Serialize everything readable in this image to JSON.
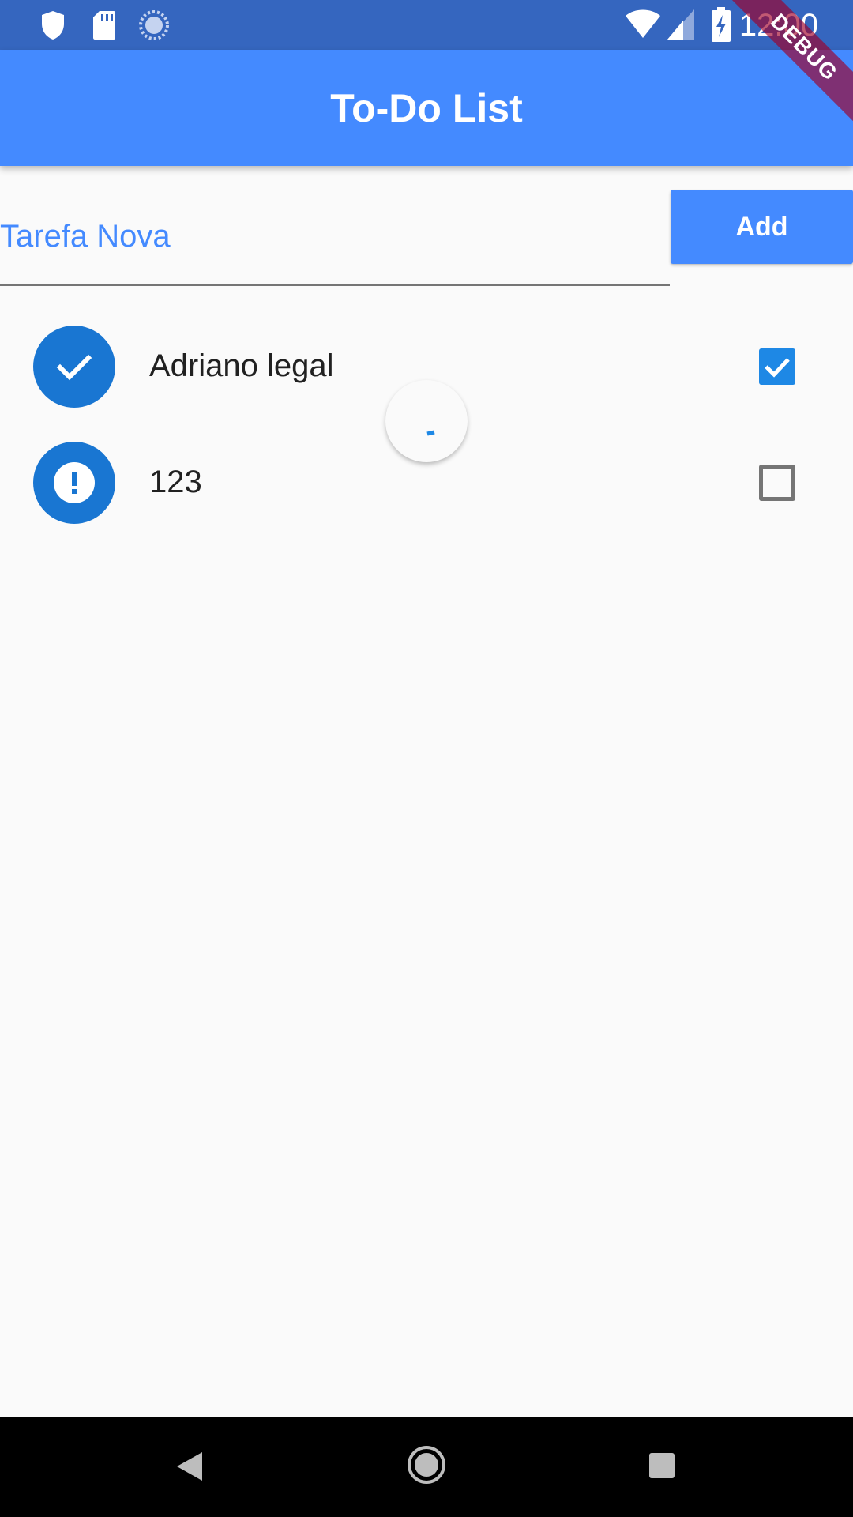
{
  "status_bar": {
    "time": "12:00",
    "left_icons": [
      "shield-icon",
      "sd-card-icon",
      "sync-icon"
    ],
    "right_icons": [
      "wifi-icon",
      "cell-signal-icon",
      "battery-charging-icon"
    ]
  },
  "debug_banner": {
    "label": "DEBUG"
  },
  "app_bar": {
    "title": "To-Do List"
  },
  "new_task": {
    "placeholder": "Tarefa Nova",
    "value": "",
    "add_label": "Add"
  },
  "tasks": [
    {
      "label": "Adriano legal",
      "done": true,
      "status_icon": "check-icon"
    },
    {
      "label": "123",
      "done": false,
      "status_icon": "error-icon"
    }
  ],
  "nav_bar": {
    "buttons": [
      "back-icon",
      "home-icon",
      "recents-icon"
    ]
  },
  "colors": {
    "status_bar": "#3566bf",
    "primary": "#448aff",
    "avatar": "#1976d2",
    "checkbox": "#1e88e5",
    "background": "#fafafa"
  }
}
